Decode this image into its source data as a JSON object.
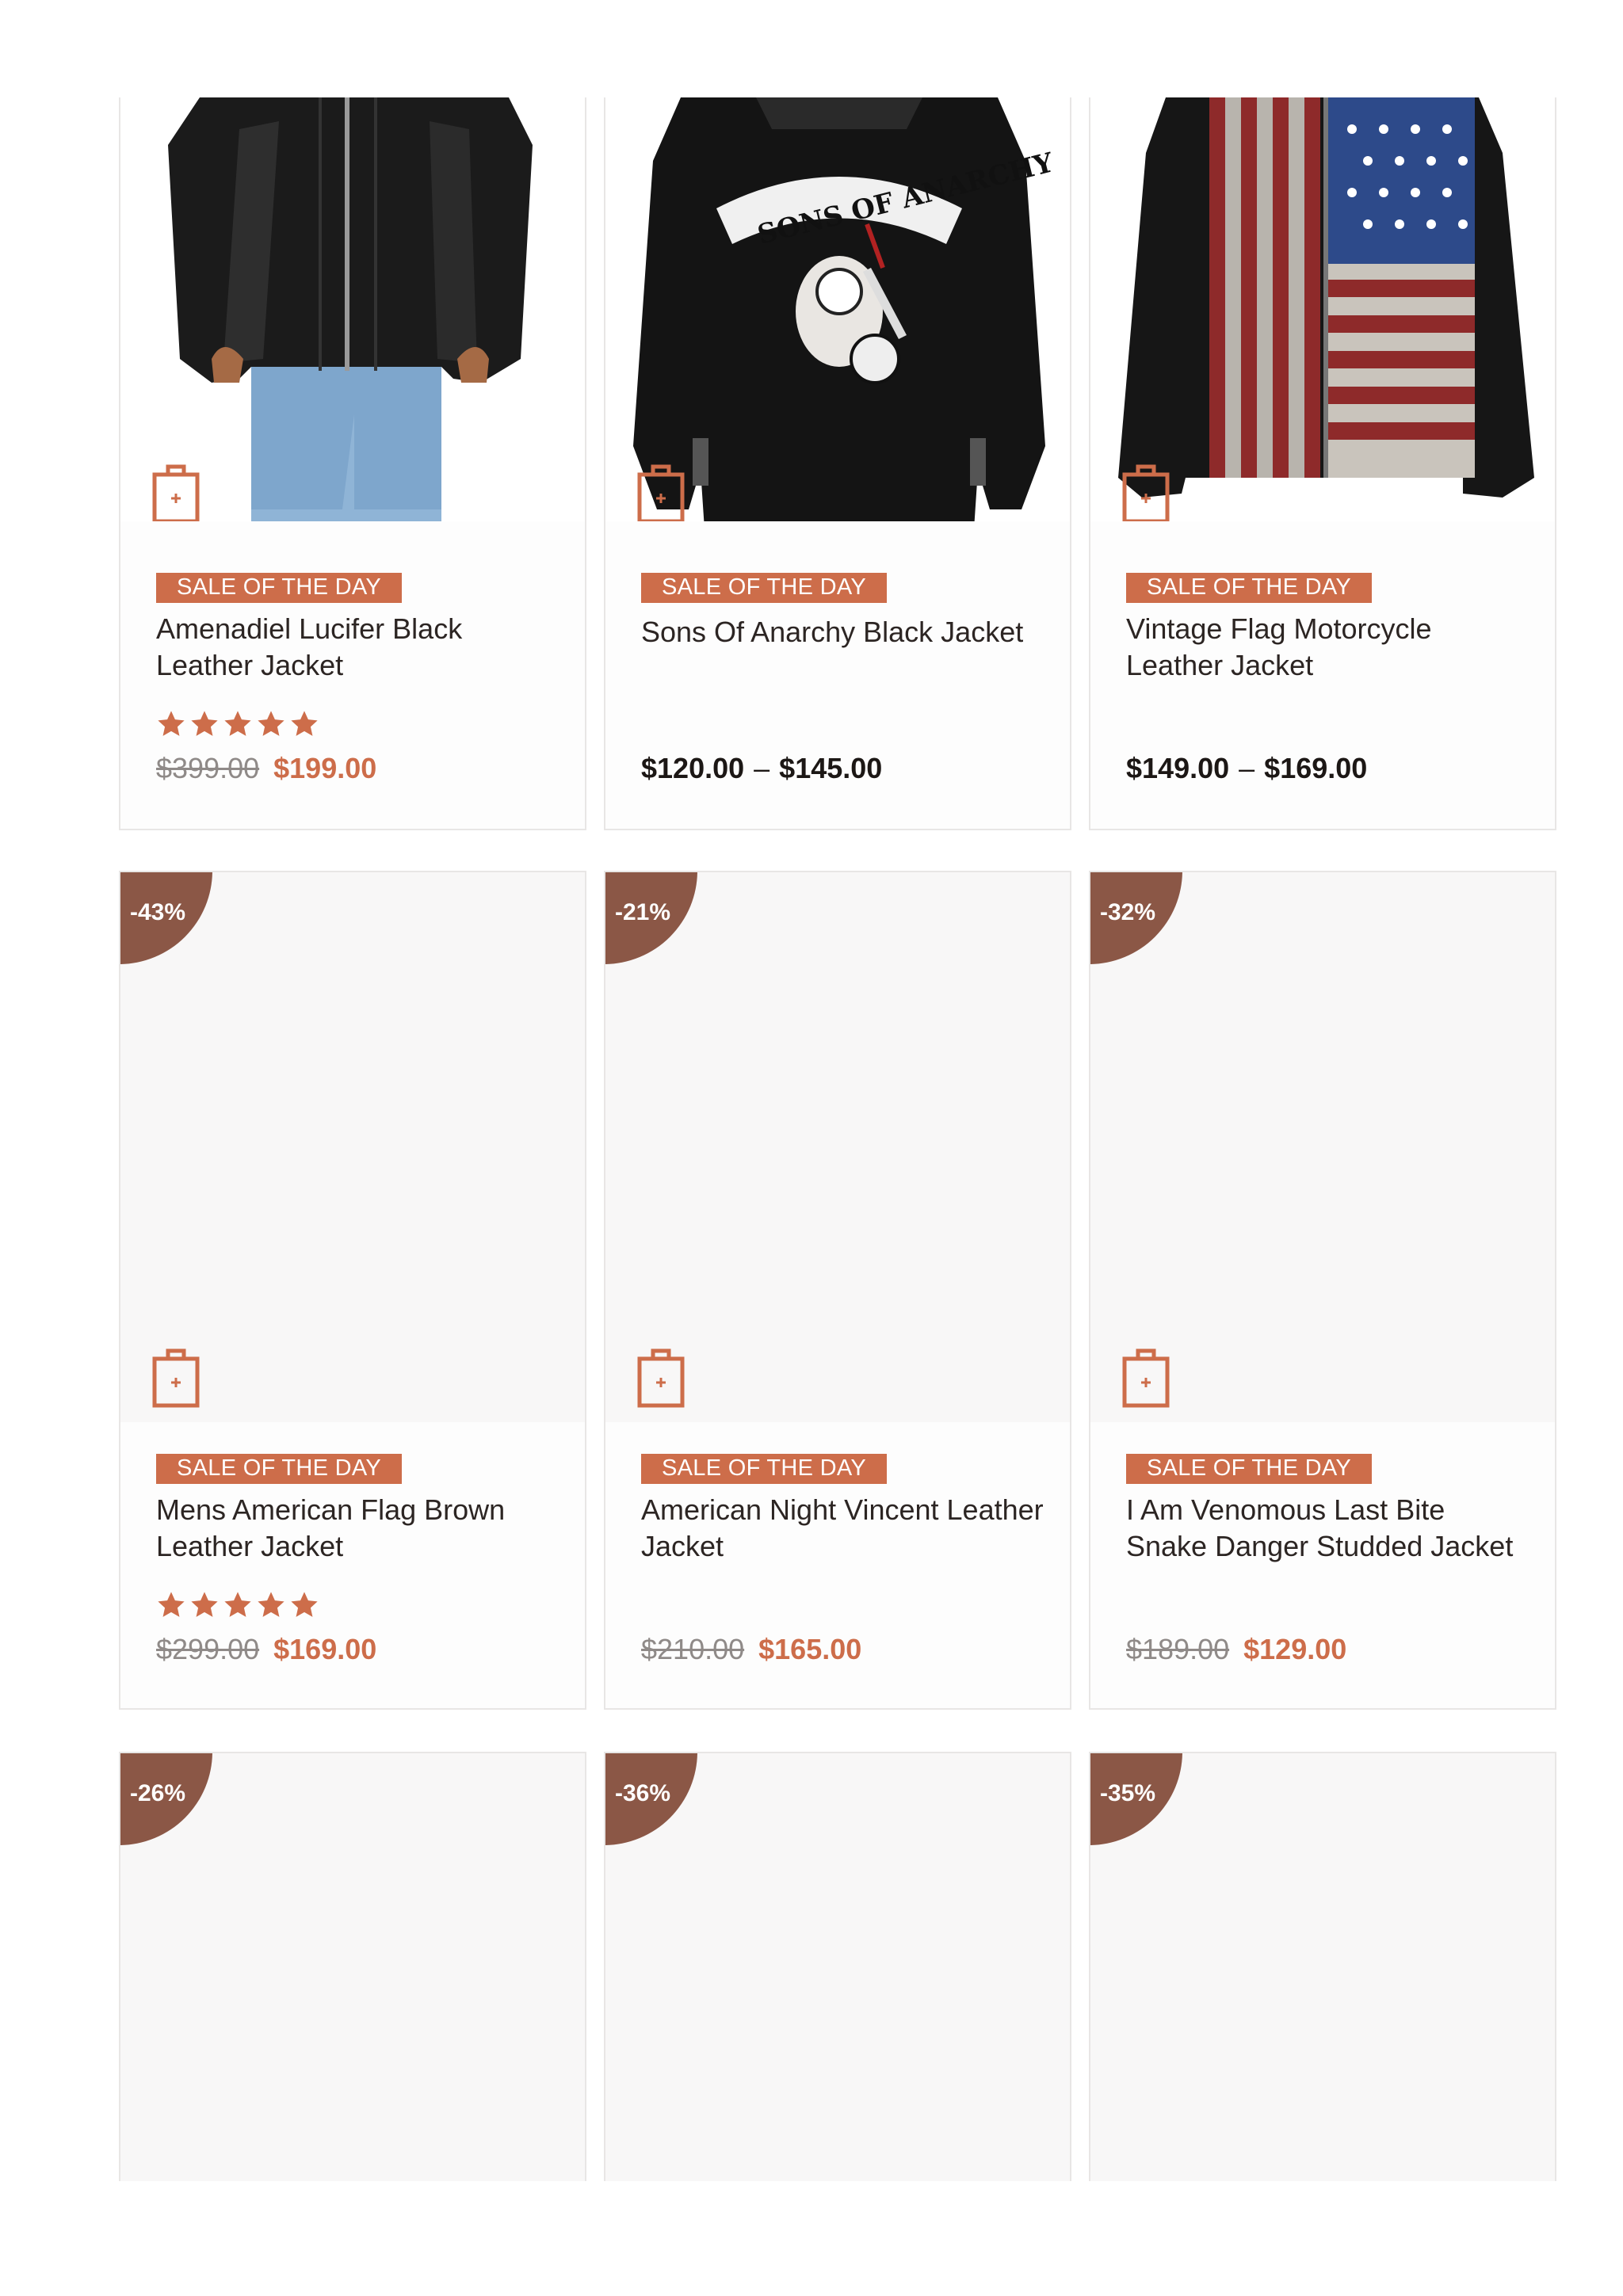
{
  "colors": {
    "accent": "#cd6d4a",
    "badge": "#8b5746",
    "card_border": "#e8e6e5",
    "text": "#2c2523"
  },
  "icons": {
    "cart": "shopping-bag-plus-icon",
    "rating": "star-icon"
  },
  "products": [
    {
      "name": "Amenadiel Lucifer Black Leather Jacket",
      "sale_tag": "SALE OF THE DAY",
      "rating": 5,
      "old_price": "$399.00",
      "price": "$199.00",
      "image": "black-leather-jacket-on-model"
    },
    {
      "name": "Sons Of Anarchy Black Jacket",
      "sale_tag": "SALE OF THE DAY",
      "price_min": "$120.00",
      "price_sep": "–",
      "price_max": "$145.00",
      "image": "sons-of-anarchy-back-patch-jacket",
      "patch_text": "SONS OF ANARCHY"
    },
    {
      "name": "Vintage Flag Motorcycle Leather Jacket",
      "sale_tag": "SALE OF THE DAY",
      "price_min": "$149.00",
      "price_sep": "–",
      "price_max": "$169.00",
      "image": "american-flag-leather-jacket"
    },
    {
      "badge": "-43%",
      "name": "Mens American Flag Brown Leather Jacket",
      "sale_tag": "SALE OF THE DAY",
      "rating": 5,
      "old_price": "$299.00",
      "price": "$169.00"
    },
    {
      "badge": "-21%",
      "name": "American Night Vincent Leather Jacket",
      "sale_tag": "SALE OF THE DAY",
      "old_price": "$210.00",
      "price": "$165.00"
    },
    {
      "badge": "-32%",
      "name": "I Am Venomous Last Bite Snake Danger Studded Jacket",
      "sale_tag": "SALE OF THE DAY",
      "old_price": "$189.00",
      "price": "$129.00"
    },
    {
      "badge": "-26%"
    },
    {
      "badge": "-36%"
    },
    {
      "badge": "-35%"
    }
  ]
}
